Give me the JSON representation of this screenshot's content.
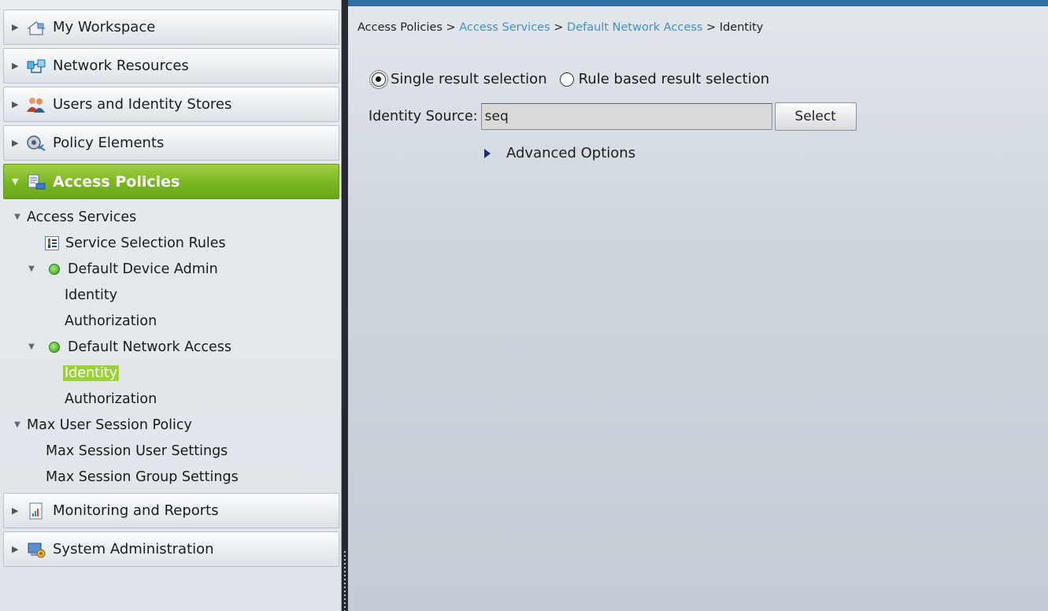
{
  "sidebar": {
    "drawers_top": [
      {
        "label": "My Workspace",
        "icon": "workspace-icon"
      },
      {
        "label": "Network Resources",
        "icon": "network-resources-icon"
      },
      {
        "label": "Users and Identity Stores",
        "icon": "users-icon"
      },
      {
        "label": "Policy Elements",
        "icon": "policy-elements-icon"
      }
    ],
    "active_drawer": {
      "label": "Access Policies",
      "icon": "access-policies-icon"
    },
    "tree": {
      "access_services": "Access Services",
      "service_selection_rules": "Service Selection Rules",
      "default_device_admin": "Default Device Admin",
      "dda_identity": "Identity",
      "dda_authorization": "Authorization",
      "default_network_access": "Default Network Access",
      "dna_identity": "Identity",
      "dna_authorization": "Authorization",
      "max_user_session_policy": "Max User Session Policy",
      "max_session_user_settings": "Max Session User Settings",
      "max_session_group_settings": "Max Session Group Settings"
    },
    "drawers_bottom": [
      {
        "label": "Monitoring and Reports",
        "icon": "monitoring-reports-icon"
      },
      {
        "label": "System Administration",
        "icon": "system-administration-icon"
      }
    ]
  },
  "breadcrumb": {
    "root": "Access Policies",
    "sep": ">",
    "access_services": "Access Services",
    "default_network_access": "Default Network Access",
    "current": "Identity"
  },
  "main": {
    "radio_single": "Single result selection",
    "radio_rule": "Rule based result selection",
    "selected_radio": "single",
    "identity_source_label": "Identity Source:",
    "identity_source_value": "seq",
    "select_button": "Select",
    "advanced_options": "Advanced Options"
  },
  "colors": {
    "active_green": "#78b421",
    "link_blue": "#3d93c8",
    "highlight_green": "#9bcf3c"
  }
}
